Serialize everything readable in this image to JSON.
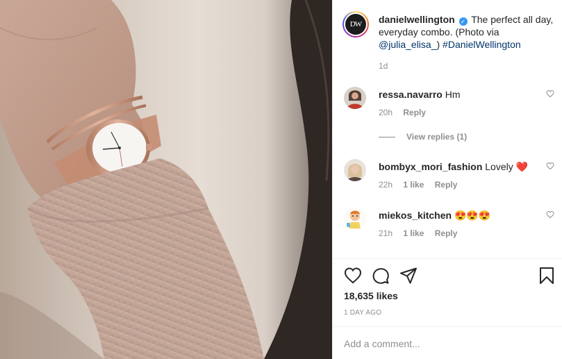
{
  "post": {
    "author": "danielwellington",
    "caption_text": "The perfect all day, everyday combo. (Photo via ",
    "mention": "@julia_elisa_",
    "caption_close": ")",
    "hashtag": "#DanielWellington",
    "caption_age": "1d",
    "avatar_text": "DW"
  },
  "comments": [
    {
      "username": "ressa.navarro",
      "text": "Hm",
      "age": "20h",
      "likes": "",
      "reply": "Reply",
      "emoji": ""
    },
    {
      "username": "bombyx_mori_fashion",
      "text": "Lovely",
      "age": "22h",
      "likes": "1 like",
      "reply": "Reply",
      "emoji": "❤️"
    },
    {
      "username": "miekos_kitchen",
      "text": "",
      "age": "21h",
      "likes": "1 like",
      "reply": "Reply",
      "emoji": "😍😍😍"
    }
  ],
  "view_replies": "View replies (1)",
  "likes_count": "18,635 likes",
  "post_date": "1 DAY AGO",
  "add_comment_placeholder": "Add a comment...",
  "icons": [
    "heart-icon",
    "comment-icon",
    "share-icon",
    "bookmark-icon",
    "verified-badge-icon"
  ],
  "colors": {
    "verified": "#3897f0",
    "link": "#003569",
    "muted": "#8e8e8e",
    "heart_emoji": "#e0245e"
  }
}
